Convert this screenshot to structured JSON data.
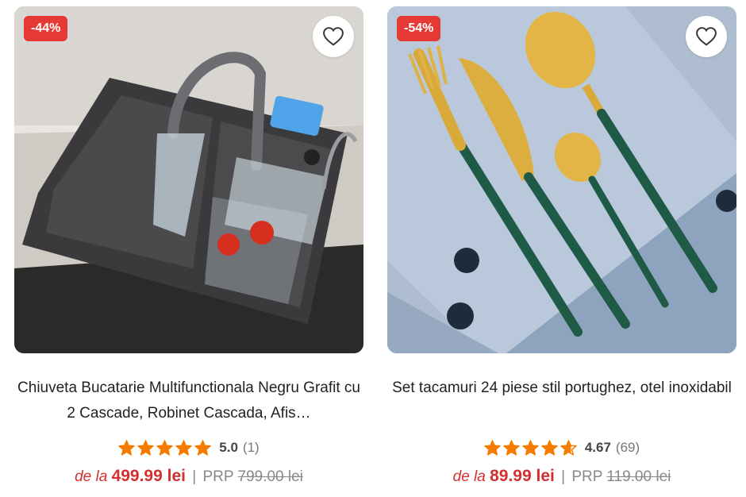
{
  "colors": {
    "accent": "#e53935",
    "price": "#d32f2f",
    "star": "#f57c00"
  },
  "products": [
    {
      "discount": "-44%",
      "title": "Chiuveta Bucatarie Multifunctionala Negru Grafit cu 2 Cascade, Robinet Cascada, Afis…",
      "rating_value": 5.0,
      "rating_text": "5.0",
      "reviews": "(1)",
      "price_prefix": "de la",
      "price": "499.99 lei",
      "separator": "|",
      "prp_label": "PRP",
      "old_price": "799.00 lei",
      "icon": "heart-icon"
    },
    {
      "discount": "-54%",
      "title": "Set tacamuri 24 piese stil portughez, otel inoxidabil",
      "rating_value": 4.67,
      "rating_text": "4.67",
      "reviews": "(69)",
      "price_prefix": "de la",
      "price": "89.99 lei",
      "separator": "|",
      "prp_label": "PRP",
      "old_price": "119.00 lei",
      "icon": "heart-icon"
    }
  ]
}
